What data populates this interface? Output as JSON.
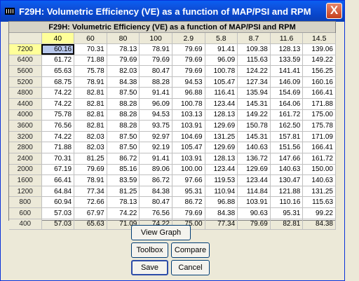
{
  "window": {
    "title": "F29H: Volumetric Efficiency (VE) as a function of MAP/PSI and RPM",
    "close_glyph": "X"
  },
  "table": {
    "title": "F29H: Volumetric Efficiency (VE) as a function of MAP/PSI and RPM",
    "columns": [
      "40",
      "60",
      "80",
      "100",
      "2.9",
      "5.8",
      "8.7",
      "11.6",
      "14.5"
    ],
    "selected_row": 0,
    "selected_col": 0,
    "rows": [
      {
        "rpm": "7200",
        "values": [
          "60.16",
          "70.31",
          "78.13",
          "78.91",
          "79.69",
          "91.41",
          "109.38",
          "128.13",
          "139.06"
        ]
      },
      {
        "rpm": "6400",
        "values": [
          "61.72",
          "71.88",
          "79.69",
          "79.69",
          "79.69",
          "96.09",
          "115.63",
          "133.59",
          "149.22"
        ]
      },
      {
        "rpm": "5600",
        "values": [
          "65.63",
          "75.78",
          "82.03",
          "80.47",
          "79.69",
          "100.78",
          "124.22",
          "141.41",
          "156.25"
        ]
      },
      {
        "rpm": "5200",
        "values": [
          "68.75",
          "78.91",
          "84.38",
          "88.28",
          "94.53",
          "105.47",
          "127.34",
          "146.09",
          "160.16"
        ]
      },
      {
        "rpm": "4800",
        "values": [
          "74.22",
          "82.81",
          "87.50",
          "91.41",
          "96.88",
          "116.41",
          "135.94",
          "154.69",
          "166.41"
        ]
      },
      {
        "rpm": "4400",
        "values": [
          "74.22",
          "82.81",
          "88.28",
          "96.09",
          "100.78",
          "123.44",
          "145.31",
          "164.06",
          "171.88"
        ]
      },
      {
        "rpm": "4000",
        "values": [
          "75.78",
          "82.81",
          "88.28",
          "94.53",
          "103.13",
          "128.13",
          "149.22",
          "161.72",
          "175.00"
        ]
      },
      {
        "rpm": "3600",
        "values": [
          "76.56",
          "82.81",
          "88.28",
          "93.75",
          "103.91",
          "129.69",
          "150.78",
          "162.50",
          "175.78"
        ]
      },
      {
        "rpm": "3200",
        "values": [
          "74.22",
          "82.03",
          "87.50",
          "92.97",
          "104.69",
          "131.25",
          "145.31",
          "157.81",
          "171.09"
        ]
      },
      {
        "rpm": "2800",
        "values": [
          "71.88",
          "82.03",
          "87.50",
          "92.19",
          "105.47",
          "129.69",
          "140.63",
          "151.56",
          "166.41"
        ]
      },
      {
        "rpm": "2400",
        "values": [
          "70.31",
          "81.25",
          "86.72",
          "91.41",
          "103.91",
          "128.13",
          "136.72",
          "147.66",
          "161.72"
        ]
      },
      {
        "rpm": "2000",
        "values": [
          "67.19",
          "79.69",
          "85.16",
          "89.06",
          "100.00",
          "123.44",
          "129.69",
          "140.63",
          "150.00"
        ]
      },
      {
        "rpm": "1600",
        "values": [
          "66.41",
          "78.91",
          "83.59",
          "86.72",
          "97.66",
          "119.53",
          "123.44",
          "130.47",
          "140.63"
        ]
      },
      {
        "rpm": "1200",
        "values": [
          "64.84",
          "77.34",
          "81.25",
          "84.38",
          "95.31",
          "110.94",
          "114.84",
          "121.88",
          "131.25"
        ]
      },
      {
        "rpm": "800",
        "values": [
          "60.94",
          "72.66",
          "78.13",
          "80.47",
          "86.72",
          "96.88",
          "103.91",
          "110.16",
          "115.63"
        ]
      },
      {
        "rpm": "600",
        "values": [
          "57.03",
          "67.97",
          "74.22",
          "76.56",
          "79.69",
          "84.38",
          "90.63",
          "95.31",
          "99.22"
        ]
      },
      {
        "rpm": "400",
        "values": [
          "57.03",
          "65.63",
          "71.09",
          "74.22",
          "75.00",
          "77.34",
          "79.69",
          "82.81",
          "84.38"
        ]
      }
    ]
  },
  "buttons": {
    "view_graph": "View Graph",
    "toolbox": "Toolbox",
    "compare": "Compare",
    "save": "Save",
    "cancel": "Cancel"
  }
}
